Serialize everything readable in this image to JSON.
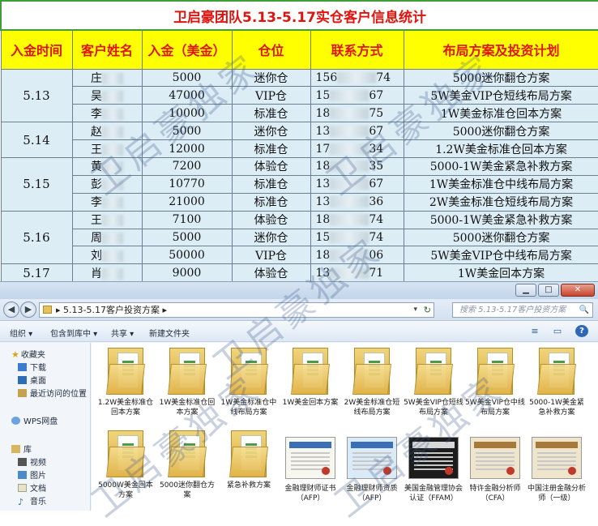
{
  "sheet": {
    "title": "卫启豪团队5.13-5.17实仓客户信息统计",
    "headers": [
      "入金时间",
      "客户姓名",
      "入金（美金）",
      "仓位",
      "联系方式",
      "布局方案及投资计划"
    ],
    "groups": [
      {
        "date": "5.13",
        "rows": [
          {
            "name": "庄",
            "amount": "5000",
            "position": "迷你仓",
            "phone_prefix": "156",
            "phone_suffix": "74",
            "plan": "5000迷你翻仓方案"
          },
          {
            "name": "吴",
            "amount": "47000",
            "position": "VIP仓",
            "phone_prefix": "15",
            "phone_suffix": "67",
            "plan": "5W美金VIP仓短线布局方案"
          },
          {
            "name": "李",
            "amount": "10000",
            "position": "标准仓",
            "phone_prefix": "18",
            "phone_suffix": "75",
            "plan": "1W美金标准仓回本方案"
          }
        ]
      },
      {
        "date": "5.14",
        "rows": [
          {
            "name": "赵",
            "amount": "5000",
            "position": "迷你仓",
            "phone_prefix": "13",
            "phone_suffix": "67",
            "plan": "5000迷你翻仓方案"
          },
          {
            "name": "王",
            "amount": "12000",
            "position": "标准仓",
            "phone_prefix": "17",
            "phone_suffix": "34",
            "plan": "1.2W美金标准仓回本方案"
          }
        ]
      },
      {
        "date": "5.15",
        "rows": [
          {
            "name": "黄",
            "amount": "7200",
            "position": "体验仓",
            "phone_prefix": "18",
            "phone_suffix": "35",
            "plan": "5000-1W美金紧急补救方案"
          },
          {
            "name": "彭",
            "amount": "10770",
            "position": "标准仓",
            "phone_prefix": "13",
            "phone_suffix": "67",
            "plan": "1W美金标准仓中线布局方案"
          },
          {
            "name": "李",
            "amount": "21000",
            "position": "标准仓",
            "phone_prefix": "13",
            "phone_suffix": "36",
            "plan": "2W美金标准仓短线布局方案"
          }
        ]
      },
      {
        "date": "5.16",
        "rows": [
          {
            "name": "王",
            "amount": "7100",
            "position": "体验仓",
            "phone_prefix": "18",
            "phone_suffix": "74",
            "plan": "5000-1W美金紧急补救方案"
          },
          {
            "name": "周",
            "amount": "5000",
            "position": "迷你仓",
            "phone_prefix": "15",
            "phone_suffix": "74",
            "plan": "5000迷你翻仓方案"
          },
          {
            "name": "刘",
            "amount": "50000",
            "position": "VIP仓",
            "phone_prefix": "18",
            "phone_suffix": "06",
            "plan": "5W美金VIP仓中线布局方案"
          }
        ]
      },
      {
        "date": "5.17",
        "rows": [
          {
            "name": "肖",
            "amount": "9000",
            "position": "体验仓",
            "phone_prefix": "13",
            "phone_suffix": "71",
            "plan": "1W美金回本方案"
          }
        ]
      }
    ]
  },
  "window": {
    "min_glyph": "▁",
    "max_glyph": "□",
    "close_glyph": "✕"
  },
  "address": {
    "path": "5.13-5.17客户投资方案",
    "separator": "▸",
    "search_placeholder": "搜索 5.13-5.17客户投资方案",
    "back_glyph": "◀",
    "forward_glyph": "▶",
    "dropdown_glyph": "▾",
    "refresh_glyph": "↻",
    "search_glyph": "🔍"
  },
  "toolbar": {
    "organize": "组织 ▾",
    "include": "包含到库中 ▾",
    "share": "共享 ▾",
    "new_folder": "新建文件夹",
    "view_glyph": "≡",
    "pane_glyph": "▭",
    "help_glyph": "?"
  },
  "nav": {
    "favorites": "收藏夹",
    "downloads": "下载",
    "desktop": "桌面",
    "recent": "最近访问的位置",
    "wps": "WPS网盘",
    "library": "库",
    "videos": "视频",
    "pictures": "图片",
    "documents": "文档",
    "music": "音乐"
  },
  "files": [
    {
      "label": "1.2W美金标准仓回本方案",
      "kind": "folder"
    },
    {
      "label": "1W美金标准仓回本方案",
      "kind": "folder"
    },
    {
      "label": "1W美金标准仓中线布局方案",
      "kind": "folder"
    },
    {
      "label": "1W美金回本方案",
      "kind": "folder"
    },
    {
      "label": "2W美金标准仓短线布局方案",
      "kind": "folder"
    },
    {
      "label": "5W美金VIP仓短线布局方案",
      "kind": "folder"
    },
    {
      "label": "5W美金VIP仓中线布局方案",
      "kind": "folder"
    },
    {
      "label": "5000-1W美金紧急补救方案",
      "kind": "folder"
    },
    {
      "label": "5000W美金回本方案",
      "kind": "folder"
    },
    {
      "label": "5000迷你翻仓方案",
      "kind": "folder"
    },
    {
      "label": "紧急补救方案",
      "kind": "folder"
    },
    {
      "label": "金融理财师证书（AFP）",
      "kind": "cert"
    },
    {
      "label": "金融理财师资质（AFP）",
      "kind": "cert-blue"
    },
    {
      "label": "美国金融管理协会认证（FFAM）",
      "kind": "cert-dark"
    },
    {
      "label": "特许金融分析师（CFA）",
      "kind": "cert-tan"
    },
    {
      "label": "中国注册金融分析师（一级）",
      "kind": "cert-tan"
    }
  ],
  "watermark": "卫启豪独家"
}
